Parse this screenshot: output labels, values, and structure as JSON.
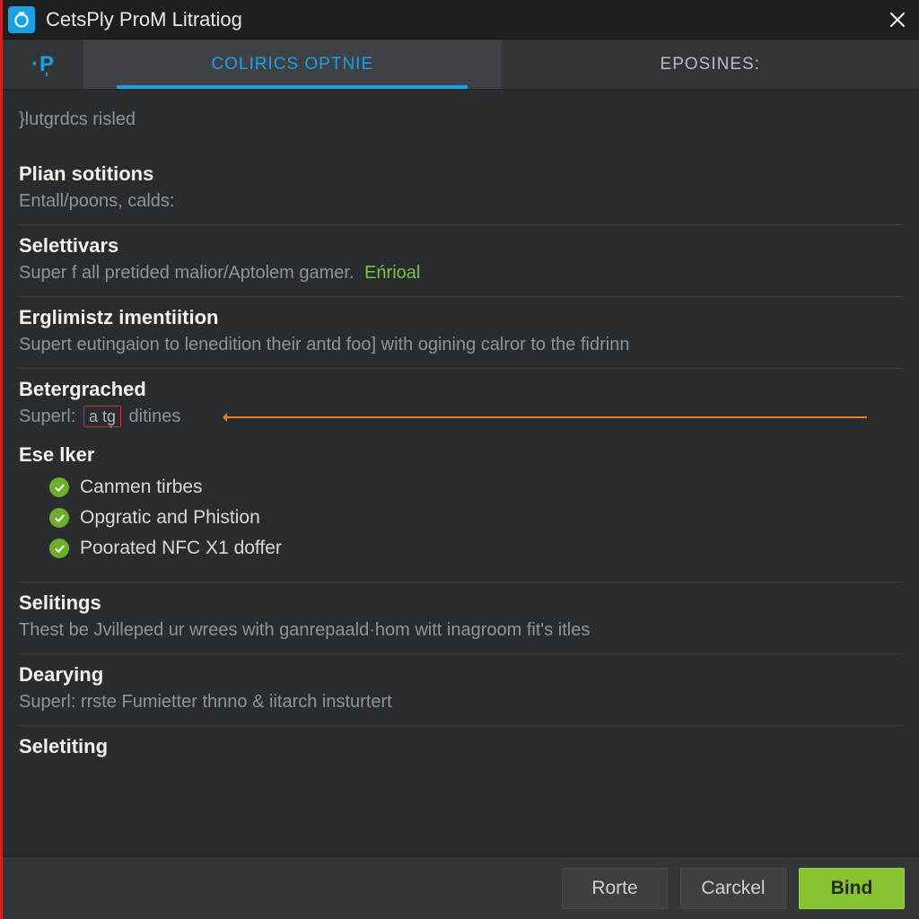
{
  "window": {
    "title": "CetsPly ProM Litratiog"
  },
  "tabs": {
    "icon_label": "·P̩",
    "active": "Colirics Optnie",
    "secondary": "Eposines:"
  },
  "intro": "}lutgrdcs risled",
  "sections": {
    "plian": {
      "title": "Plian sotitions",
      "desc": "Entall/poons, calds:"
    },
    "selettivars": {
      "title": "Selettivars",
      "desc_pre": "Super f all pretided malior/Aptolem gamer.",
      "badge": "Eńrioal"
    },
    "erglim": {
      "title": "Erglimistz imentiition",
      "desc": "Supert eutingaion to lenedition  their antd foo] with ogining calror to the fidrinn"
    },
    "beter": {
      "title": "Betergrached",
      "desc_pre": "Superl: ",
      "chip": "a tg̣",
      "desc_post": " ditines"
    },
    "eselker": {
      "title": "Ese lker",
      "items": [
        "Canmen tirbes",
        "Opgratic and Phistion",
        "Poorated NFC X1 doffer"
      ]
    },
    "selitings": {
      "title": "Selitings",
      "desc": "Thest be Jvilleped ur wrees with ganrepaald·hom witt inagroom fit's itles"
    },
    "dearying": {
      "title": "Dearying",
      "desc": "Superl: rrste Fumietter thnno & iitarch insturtert"
    },
    "seletiting": {
      "title": "Seletiting"
    }
  },
  "footer": {
    "rorte": "Rorte",
    "cancel": "Carckel",
    "bind": "Bind"
  }
}
